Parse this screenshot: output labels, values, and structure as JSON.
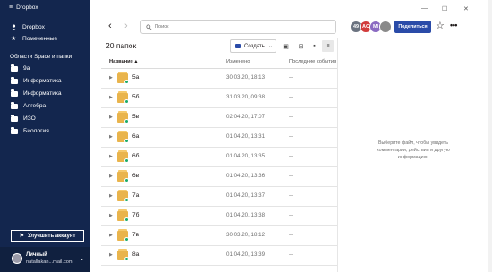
{
  "sidebar": {
    "title": "Dropbox",
    "items": [
      {
        "label": "Dropbox"
      },
      {
        "label": "Помеченные"
      }
    ],
    "section_title": "Области Space и папки",
    "folders": [
      {
        "label": "9а"
      },
      {
        "label": "Информатика"
      },
      {
        "label": "Информатика"
      },
      {
        "label": "Алгебра"
      },
      {
        "label": "ИЗО"
      },
      {
        "label": "Биология"
      }
    ],
    "upgrade_label": "Улучшить аккаунт",
    "account": {
      "name": "Личный",
      "email": "natallakan...mail.com"
    }
  },
  "toolbar": {
    "search_placeholder": "Поиск",
    "avatars": [
      {
        "text": "49",
        "color": "#6b7380"
      },
      {
        "text": "AC",
        "color": "#d13b3b"
      },
      {
        "text": "MI",
        "color": "#8b6bc2"
      },
      {
        "text": "",
        "color": "#8a8a8a"
      }
    ],
    "share_label": "Поделиться"
  },
  "content": {
    "count_label": "20 папок",
    "create_label": "Создать",
    "columns": {
      "name": "Название",
      "modified": "Изменено",
      "activity": "Последние события"
    },
    "rows": [
      {
        "name": "5а",
        "modified": "30.03.20, 18:13",
        "activity": "--"
      },
      {
        "name": "5б",
        "modified": "31.03.20, 09:38",
        "activity": "--"
      },
      {
        "name": "5в",
        "modified": "02.04.20, 17:07",
        "activity": "--"
      },
      {
        "name": "6а",
        "modified": "01.04.20, 13:31",
        "activity": "--"
      },
      {
        "name": "6б",
        "modified": "01.04.20, 13:35",
        "activity": "--"
      },
      {
        "name": "6в",
        "modified": "01.04.20, 13:36",
        "activity": "--"
      },
      {
        "name": "7а",
        "modified": "01.04.20, 13:37",
        "activity": "--"
      },
      {
        "name": "7б",
        "modified": "01.04.20, 13:38",
        "activity": "--"
      },
      {
        "name": "7в",
        "modified": "30.03.20, 18:12",
        "activity": "--"
      },
      {
        "name": "8а",
        "modified": "01.04.20, 13:39",
        "activity": "--"
      }
    ]
  },
  "details": {
    "hint": "Выберите файл, чтобы увидеть комментарии, действия и другую информацию."
  }
}
